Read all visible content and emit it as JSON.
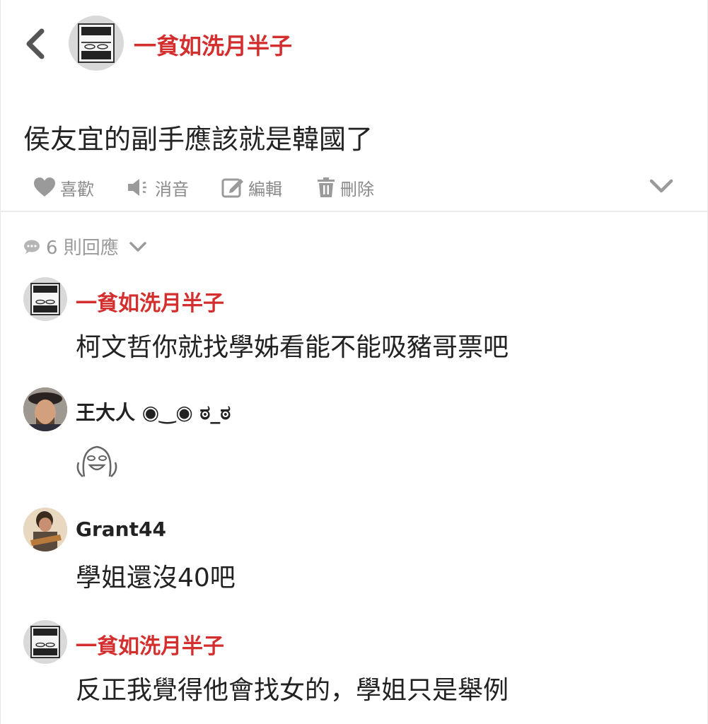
{
  "header": {
    "back_icon": "chevron-left-icon",
    "author": "一貧如洗月半子",
    "accent": "#d32f2f"
  },
  "post": {
    "text": "侯友宜的副手應該就是韓國了"
  },
  "actions": {
    "like": "喜歡",
    "mute": "消音",
    "edit": "編輯",
    "delete": "刪除",
    "more_icon": "chevron-down-icon"
  },
  "replies": {
    "count_label": "6 則回應"
  },
  "comments": [
    {
      "author": "一貧如洗月半子",
      "text": "柯文哲你就找學姊看能不能吸豬哥票吧"
    },
    {
      "author": "王大人 ◉‿◉ ಠ_ಠ",
      "sticker": "ghost-sticker-icon"
    },
    {
      "author": "Grant44",
      "text": "學姐還沒40吧"
    },
    {
      "author": "一貧如洗月半子",
      "text": "反正我覺得他會找女的，學姐只是舉例"
    }
  ]
}
